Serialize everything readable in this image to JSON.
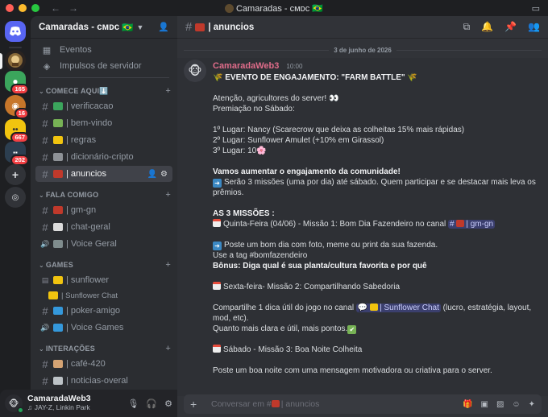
{
  "window": {
    "title": "Camaradas - ᴄᴍᴅᴄ 🇧🇷",
    "nav_back": "←",
    "nav_forward": "→"
  },
  "rail": {
    "badges": [
      "165",
      "16",
      "667",
      "202"
    ]
  },
  "server": {
    "name": "Camaradas - ᴄᴍᴅᴄ",
    "flag": "🇧🇷",
    "nav": [
      {
        "icon": "calendar-icon",
        "glyph": "▦",
        "label": "Eventos"
      },
      {
        "icon": "boost-icon",
        "glyph": "◈",
        "label": "Impulsos de servidor"
      }
    ]
  },
  "categories": [
    {
      "name": "COMECE AQUI⬇️",
      "channels": [
        {
          "type": "text",
          "emoji_color": "#3ba55c",
          "label": "| verificacao"
        },
        {
          "type": "text",
          "emoji_color": "#77b255",
          "label": "| bem-vindo"
        },
        {
          "type": "text",
          "emoji_color": "#f1c40f",
          "label": "| regras"
        },
        {
          "type": "text",
          "emoji_color": "#8e9297",
          "label": "| dicionário-cripto"
        },
        {
          "type": "text",
          "emoji_color": "#c0392b",
          "label": "| anuncios",
          "active": true
        }
      ]
    },
    {
      "name": "FALA COMIGO",
      "channels": [
        {
          "type": "text",
          "emoji_color": "#c0392b",
          "label": "| gm-gn"
        },
        {
          "type": "text",
          "emoji_color": "#dcdcdc",
          "label": "| chat-geral"
        },
        {
          "type": "voice",
          "emoji_color": "#7f8c8d",
          "label": "| Voice Geral"
        }
      ]
    },
    {
      "name": "GAMES",
      "channels": [
        {
          "type": "forum",
          "emoji_color": "#f1c40f",
          "label": "| sunflower"
        },
        {
          "type": "thread",
          "emoji_color": "#f1c40f",
          "label": "| Sunflower Chat"
        },
        {
          "type": "text",
          "emoji_color": "#3498db",
          "label": "| poker-amigo"
        },
        {
          "type": "voice",
          "emoji_color": "#3498db",
          "label": "| Voice Games"
        }
      ]
    },
    {
      "name": "INTERAÇÕES",
      "channels": [
        {
          "type": "text",
          "emoji_color": "#d4a373",
          "label": "| café-420"
        },
        {
          "type": "text",
          "emoji_color": "#bdc3c7",
          "label": "| noticias-overal"
        }
      ]
    }
  ],
  "user": {
    "name": "CamaradaWeb3",
    "activity": "JAY-Z, Linkin Park"
  },
  "channel": {
    "name": "| anuncios",
    "date_divider": "3 de junho de 2026",
    "composer_placeholder": "Conversar em #",
    "composer_channel": "| anuncios"
  },
  "message": {
    "author": "CamaradaWeb3",
    "time": "10:00",
    "title": "EVENTO DE ENGAJAMENTO: \"FARM BATTLE\"",
    "l1": "Atenção, agricultores do server! 👀",
    "l2": "Premiação no Sábado:",
    "p1": "1º Lugar: Nancy (Scarecrow que deixa as colheitas 15% mais rápidas)",
    "p2": "2º Lugar: Sunflower Amulet (+10% em Girassol)",
    "p3": "3º Lugar: 10",
    "engage_title": "Vamos aumentar o engajamento da comunidade!",
    "engage_body": "Serão 3 missões (uma por dia) até sábado. Quem participar e se destacar mais leva os prêmios.",
    "missions_title": "AS 3 MISSÕES :",
    "m1": "Quinta-Feira (04/06) - Missão 1: Bom Dia Fazendeiro no canal",
    "m1_mention": "| gm-gn",
    "m1_a": "Poste um bom dia com foto, meme ou print da sua fazenda.",
    "m1_b": "Use a tag #bomfazendeiro",
    "m1_c": "Bônus: Diga qual é sua planta/cultura favorita e por quê",
    "m2": "Sexta-feira- Missão 2: Compartilhando Sabedoria",
    "m2_a": "Compartilhe 1 dica útil do jogo no canal",
    "m2_mention": "| Sunflower Chat",
    "m2_a_tail": "(lucro, estratégia, layout, mod, etc).",
    "m2_b": "Quanto mais clara e útil, mais pontos.",
    "m3": "Sábado - Missão 3: Boa Noite Colheita",
    "m3_a": "Poste um boa noite com uma mensagem motivadora ou criativa para o server."
  }
}
